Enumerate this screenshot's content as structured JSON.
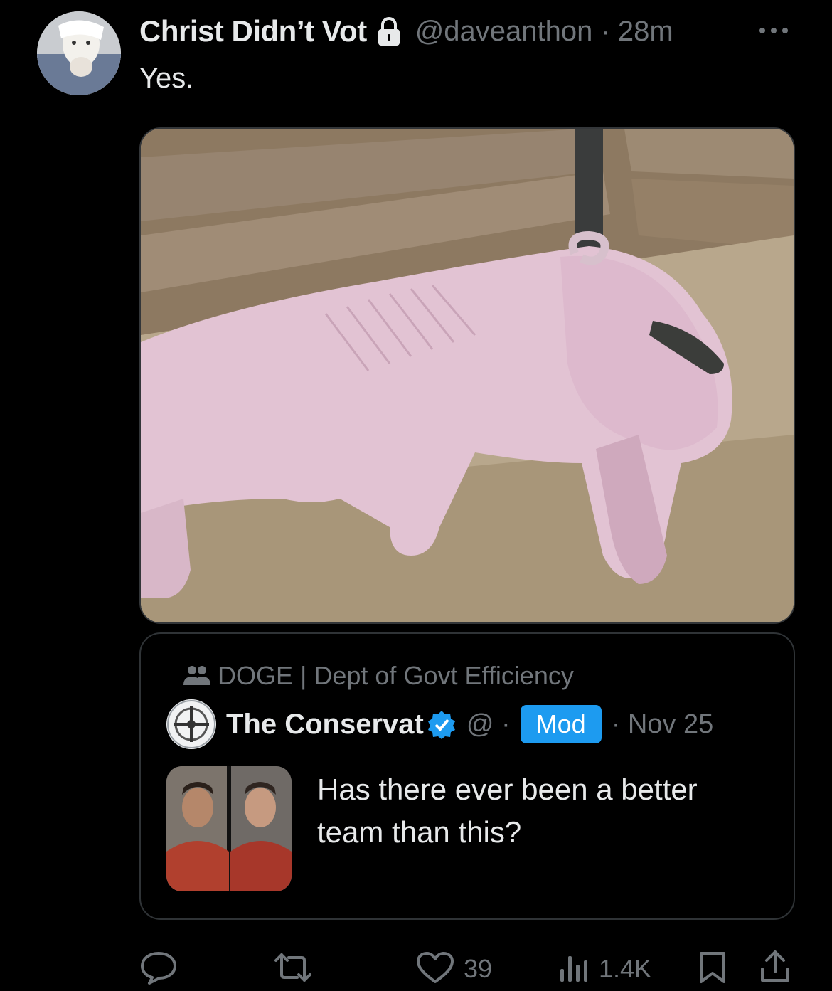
{
  "post": {
    "author_name": "Christ Didn’t Vot",
    "handle_time": "@daveanthon · 28m",
    "text": "Yes.",
    "media_alt": "pig-photo"
  },
  "quote": {
    "community": "DOGE | Dept of Govt Efficiency",
    "author_name": "The Conservat",
    "handle": "@ ·",
    "mod_badge": "Mod",
    "date": "· Nov 25",
    "text": "Has there ever been a better team than this?"
  },
  "actions": {
    "likes": "39",
    "views": "1.4K"
  },
  "icons": [
    "lock-icon",
    "more-icon",
    "community-icon",
    "verified-icon",
    "reply-icon",
    "repost-icon",
    "like-icon",
    "views-icon",
    "bookmark-icon",
    "share-icon"
  ],
  "colors": {
    "background": "#000000",
    "text": "#e7e9ea",
    "muted": "#71767b",
    "accent": "#1d9bf0"
  }
}
